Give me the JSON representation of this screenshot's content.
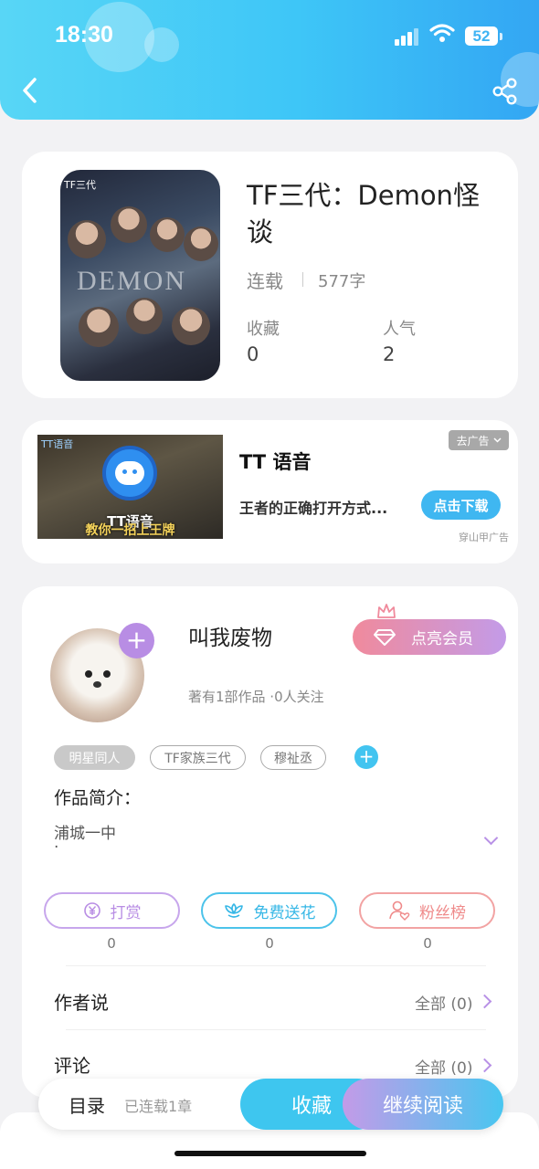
{
  "status_bar": {
    "time": "18:30",
    "battery": "52"
  },
  "header": {
    "back_icon": "chevron-left-icon",
    "share_icon": "share-icon"
  },
  "book": {
    "cover_text_line1": "TF三代",
    "cover_text_line2": "DEMON",
    "title": "TF三代：Demon怪谈",
    "status": "连载",
    "word_count": "577字",
    "favorites_label": "收藏",
    "favorites_value": "0",
    "popularity_label": "人气",
    "popularity_value": "2"
  },
  "ad": {
    "thumb_caption": "TT语音",
    "thumb_banner": "教你一招上王牌",
    "title": "TT 语音",
    "description": "王者的正确打开方式...",
    "button": "点击下载",
    "remove_label": "去广告",
    "source": "穿山甲广告"
  },
  "author": {
    "name": "叫我废物",
    "stats": "著有1部作品 ·0人关注",
    "vip_button": "点亮会员",
    "tags": [
      "明星同人",
      "TF家族三代",
      "穆祉丞"
    ],
    "intro_label": "作品简介：",
    "intro_text": "浦城一中",
    "intro_dot": "·"
  },
  "actions": [
    {
      "label": "打赏",
      "count": "0",
      "icon": "yen-coin-icon",
      "color": "#b88de4"
    },
    {
      "label": "免费送花",
      "count": "0",
      "icon": "flower-icon",
      "color": "#4cc3ea"
    },
    {
      "label": "粉丝榜",
      "count": "0",
      "icon": "user-heart-icon",
      "color": "#ef8a8a"
    }
  ],
  "sections": {
    "author_says": "作者说",
    "author_says_all": "全部 (0)",
    "comments": "评论",
    "comments_all": "全部 (0)"
  },
  "bottom_bar": {
    "catalog": "目录",
    "chapters": "已连载1章",
    "favorite": "收藏",
    "continue": "继续阅读"
  },
  "colors": {
    "header_gradient": [
      "#58d6f6",
      "#33a6f3"
    ],
    "vip_gradient": [
      "#f08a9c",
      "#c39be8"
    ],
    "download_button": "#3fb7f1",
    "favorite_button": "#3ec6ef",
    "continue_gradient": [
      "#c39be8",
      "#48c6f0"
    ]
  }
}
